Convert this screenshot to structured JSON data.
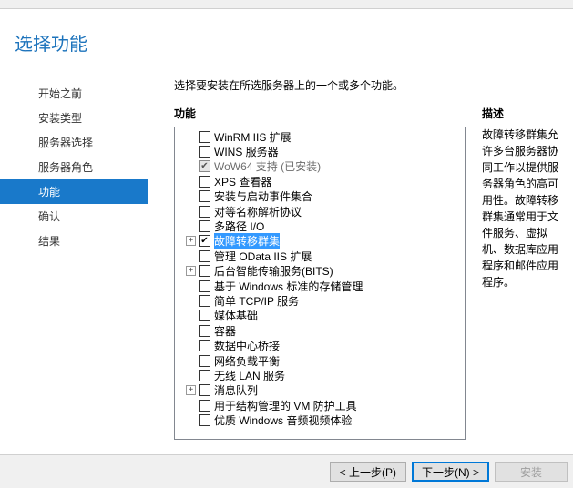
{
  "page_title": "选择功能",
  "intro_text": "选择要安装在所选服务器上的一个或多个功能。",
  "nav": {
    "items": [
      {
        "label": "开始之前"
      },
      {
        "label": "安装类型"
      },
      {
        "label": "服务器选择"
      },
      {
        "label": "服务器角色"
      },
      {
        "label": "功能",
        "selected": true
      },
      {
        "label": "确认"
      },
      {
        "label": "结果"
      }
    ]
  },
  "features": {
    "heading": "功能",
    "items": [
      {
        "label": "WinRM IIS 扩展",
        "checked": false,
        "expandable": false
      },
      {
        "label": "WINS 服务器",
        "checked": false,
        "expandable": false
      },
      {
        "label": "WoW64 支持 (已安装)",
        "checked": true,
        "expandable": false,
        "disabled": true
      },
      {
        "label": "XPS 查看器",
        "checked": false,
        "expandable": false
      },
      {
        "label": "安装与启动事件集合",
        "checked": false,
        "expandable": false
      },
      {
        "label": "对等名称解析协议",
        "checked": false,
        "expandable": false
      },
      {
        "label": "多路径 I/O",
        "checked": false,
        "expandable": false
      },
      {
        "label": "故障转移群集",
        "checked": true,
        "expandable": true,
        "selected": true
      },
      {
        "label": "管理 OData IIS 扩展",
        "checked": false,
        "expandable": false
      },
      {
        "label": "后台智能传输服务(BITS)",
        "checked": false,
        "expandable": true
      },
      {
        "label": "基于 Windows 标准的存储管理",
        "checked": false,
        "expandable": false
      },
      {
        "label": "简单 TCP/IP 服务",
        "checked": false,
        "expandable": false
      },
      {
        "label": "媒体基础",
        "checked": false,
        "expandable": false
      },
      {
        "label": "容器",
        "checked": false,
        "expandable": false
      },
      {
        "label": "数据中心桥接",
        "checked": false,
        "expandable": false
      },
      {
        "label": "网络负载平衡",
        "checked": false,
        "expandable": false
      },
      {
        "label": "无线 LAN 服务",
        "checked": false,
        "expandable": false
      },
      {
        "label": "消息队列",
        "checked": false,
        "expandable": true
      },
      {
        "label": "用于结构管理的 VM 防护工具",
        "checked": false,
        "expandable": false
      },
      {
        "label": "优质 Windows 音频视频体验",
        "checked": false,
        "expandable": false
      }
    ]
  },
  "description": {
    "heading": "描述",
    "text": "故障转移群集允许多台服务器协同工作以提供服务器角色的高可用性。故障转移群集通常用于文件服务、虚拟机、数据库应用程序和邮件应用程序。"
  },
  "buttons": {
    "prev": "< 上一步(P)",
    "next": "下一步(N) >",
    "install": "安装"
  }
}
